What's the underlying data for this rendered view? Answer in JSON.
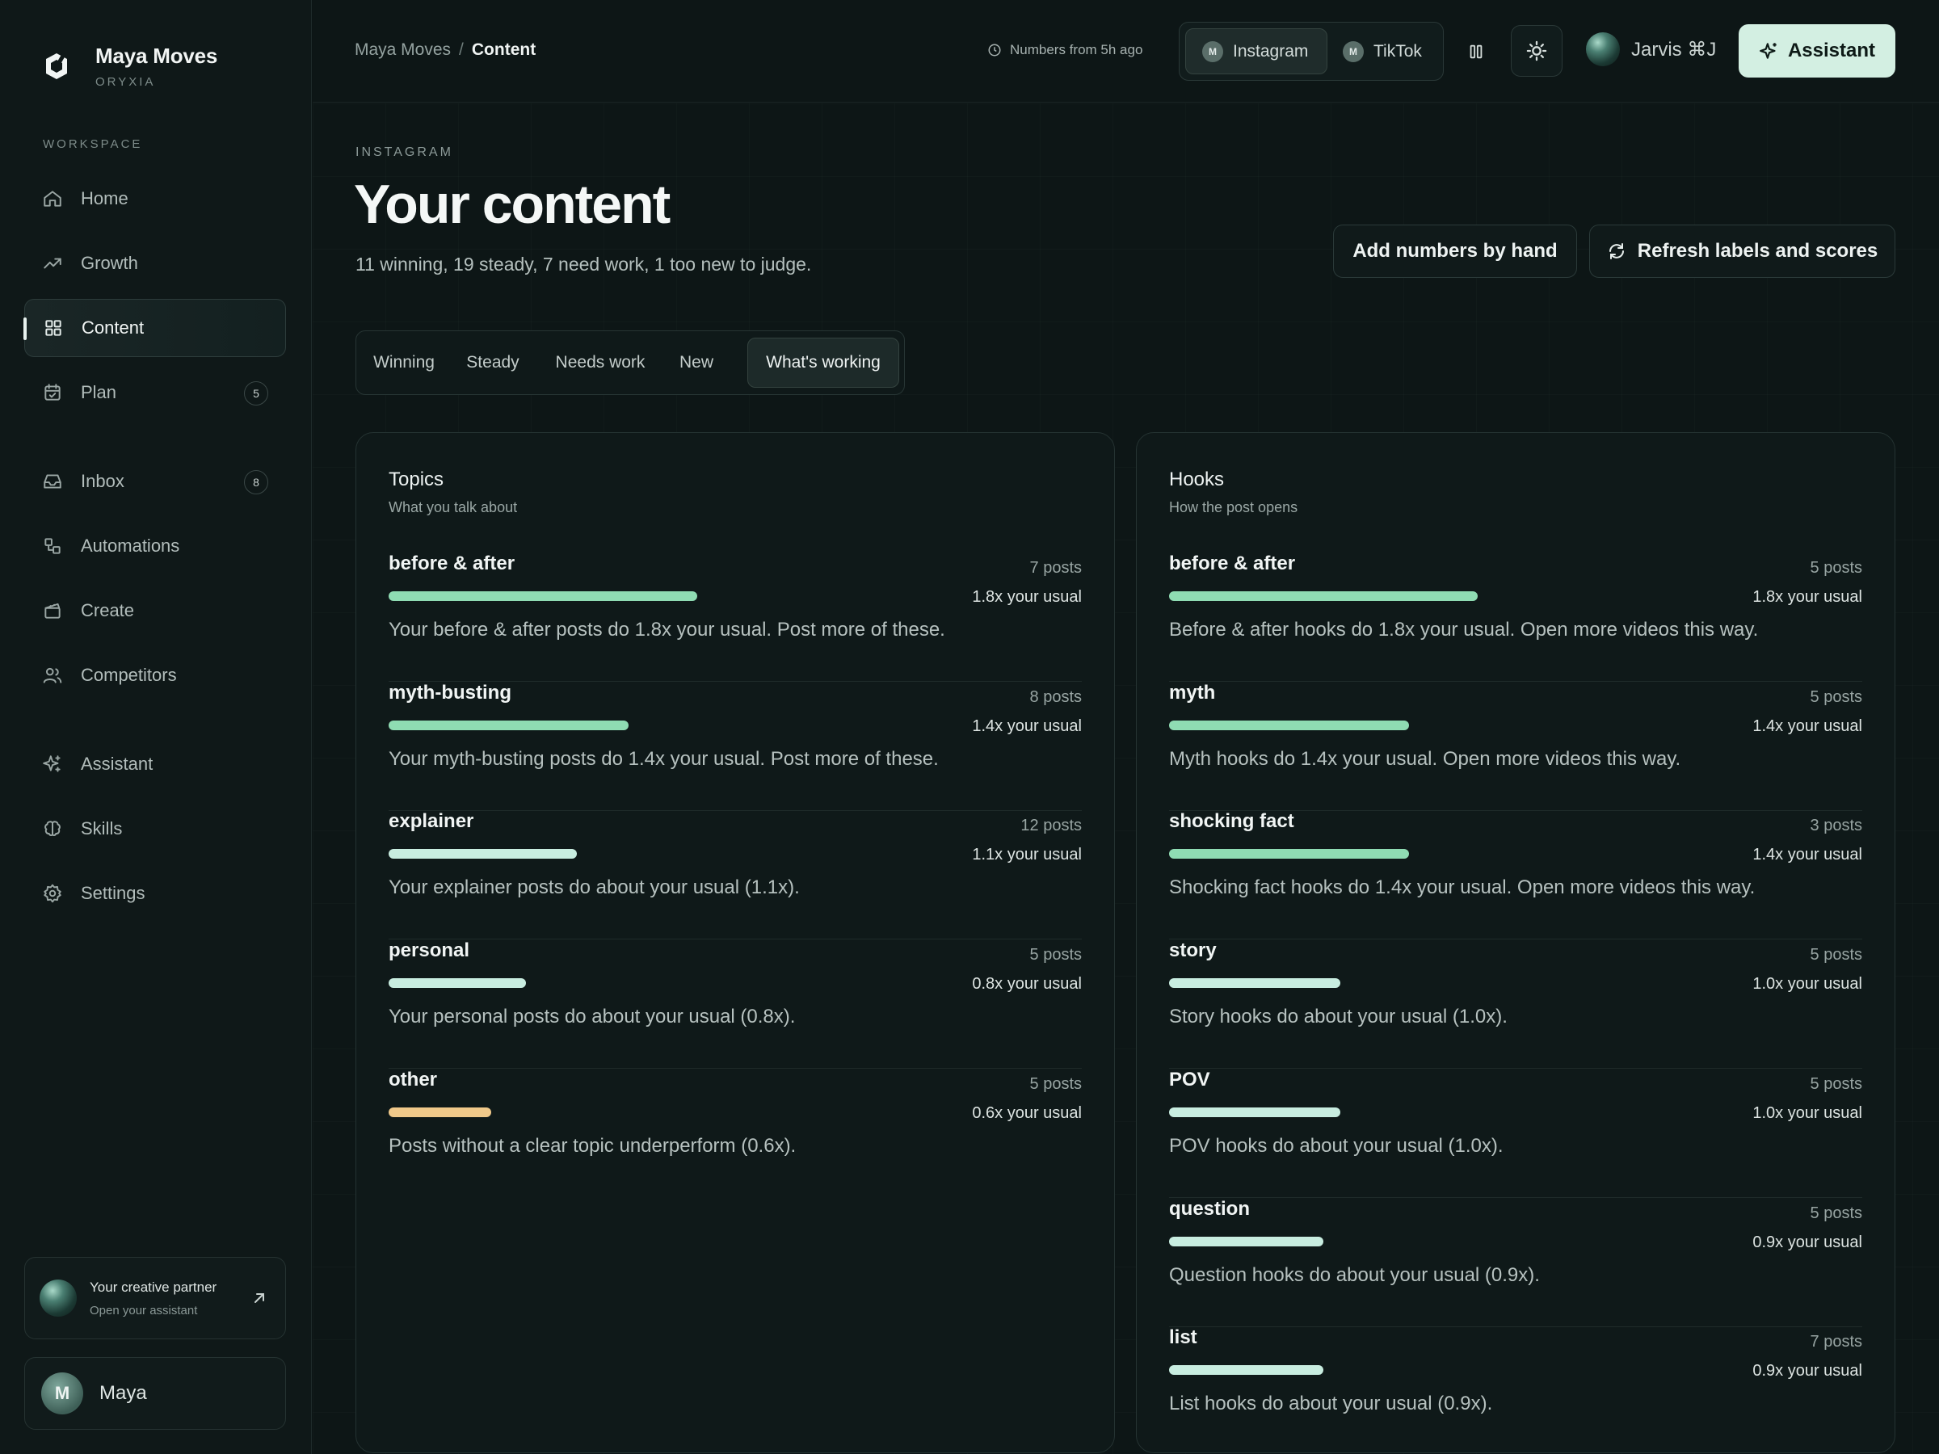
{
  "brand": {
    "name": "Maya Moves",
    "sub": "ORYXIA"
  },
  "sidebar": {
    "section_label": "WORKSPACE",
    "items": [
      {
        "label": "Home",
        "icon": "home-icon"
      },
      {
        "label": "Growth",
        "icon": "trending-up-icon"
      },
      {
        "label": "Content",
        "icon": "grid-icon",
        "active": true
      },
      {
        "label": "Plan",
        "icon": "calendar-icon",
        "badge": "5"
      },
      {
        "label": "Inbox",
        "icon": "inbox-icon",
        "badge": "8"
      },
      {
        "label": "Automations",
        "icon": "workflow-icon"
      },
      {
        "label": "Create",
        "icon": "clapperboard-icon"
      },
      {
        "label": "Competitors",
        "icon": "users-icon"
      },
      {
        "label": "Assistant",
        "icon": "sparkles-icon"
      },
      {
        "label": "Skills",
        "icon": "brain-icon"
      },
      {
        "label": "Settings",
        "icon": "gear-icon"
      }
    ],
    "partner": {
      "title": "Your creative partner",
      "subtitle": "Open your assistant"
    },
    "user": {
      "initial": "M",
      "name": "Maya"
    }
  },
  "header": {
    "breadcrumb_parent": "Maya Moves",
    "breadcrumb_sep": "/",
    "breadcrumb_current": "Content",
    "freshness": "Numbers from 5h ago",
    "platforms": [
      {
        "initial": "M",
        "label": "Instagram",
        "active": true
      },
      {
        "initial": "M",
        "label": "TikTok"
      }
    ],
    "jarvis_label": "Jarvis ⌘J",
    "assistant_label": "Assistant"
  },
  "page": {
    "eyebrow": "INSTAGRAM",
    "title": "Your content",
    "summary": "11 winning, 19 steady, 7 need work, 1 too new to judge.",
    "add_numbers_label": "Add numbers by hand",
    "refresh_label": "Refresh labels and scores",
    "tabs": [
      {
        "label": "Winning"
      },
      {
        "label": "Steady"
      },
      {
        "label": "Needs work"
      },
      {
        "label": "New"
      },
      {
        "label": "What's working",
        "active": true
      }
    ]
  },
  "colors": {
    "bar_high": "#8fdcb3",
    "bar_mid": "#c8ede0",
    "bar_low": "#f0c98a",
    "accent": "#d3efe2"
  },
  "topics": {
    "title": "Topics",
    "subtitle": "What you talk about",
    "rows": [
      {
        "name": "before & after",
        "posts": "7 posts",
        "multiplier": "1.8x your usual",
        "value": 1.8,
        "note": "Your before & after posts do 1.8x your usual. Post more of these.",
        "level": "high"
      },
      {
        "name": "myth-busting",
        "posts": "8 posts",
        "multiplier": "1.4x your usual",
        "value": 1.4,
        "note": "Your myth-busting posts do 1.4x your usual. Post more of these.",
        "level": "high"
      },
      {
        "name": "explainer",
        "posts": "12 posts",
        "multiplier": "1.1x your usual",
        "value": 1.1,
        "note": "Your explainer posts do about your usual (1.1x).",
        "level": "mid"
      },
      {
        "name": "personal",
        "posts": "5 posts",
        "multiplier": "0.8x your usual",
        "value": 0.8,
        "note": "Your personal posts do about your usual (0.8x).",
        "level": "mid"
      },
      {
        "name": "other",
        "posts": "5 posts",
        "multiplier": "0.6x your usual",
        "value": 0.6,
        "note": "Posts without a clear topic underperform (0.6x).",
        "level": "low"
      }
    ]
  },
  "hooks": {
    "title": "Hooks",
    "subtitle": "How the post opens",
    "rows": [
      {
        "name": "before & after",
        "posts": "5 posts",
        "multiplier": "1.8x your usual",
        "value": 1.8,
        "note": "Before & after hooks do 1.8x your usual. Open more videos this way.",
        "level": "high"
      },
      {
        "name": "myth",
        "posts": "5 posts",
        "multiplier": "1.4x your usual",
        "value": 1.4,
        "note": "Myth hooks do 1.4x your usual. Open more videos this way.",
        "level": "high"
      },
      {
        "name": "shocking fact",
        "posts": "3 posts",
        "multiplier": "1.4x your usual",
        "value": 1.4,
        "note": "Shocking fact hooks do 1.4x your usual. Open more videos this way.",
        "level": "high"
      },
      {
        "name": "story",
        "posts": "5 posts",
        "multiplier": "1.0x your usual",
        "value": 1.0,
        "note": "Story hooks do about your usual (1.0x).",
        "level": "mid"
      },
      {
        "name": "POV",
        "posts": "5 posts",
        "multiplier": "1.0x your usual",
        "value": 1.0,
        "note": "POV hooks do about your usual (1.0x).",
        "level": "mid"
      },
      {
        "name": "question",
        "posts": "5 posts",
        "multiplier": "0.9x your usual",
        "value": 0.9,
        "note": "Question hooks do about your usual (0.9x).",
        "level": "mid"
      },
      {
        "name": "list",
        "posts": "7 posts",
        "multiplier": "0.9x your usual",
        "value": 0.9,
        "note": "List hooks do about your usual (0.9x).",
        "level": "mid"
      }
    ]
  }
}
